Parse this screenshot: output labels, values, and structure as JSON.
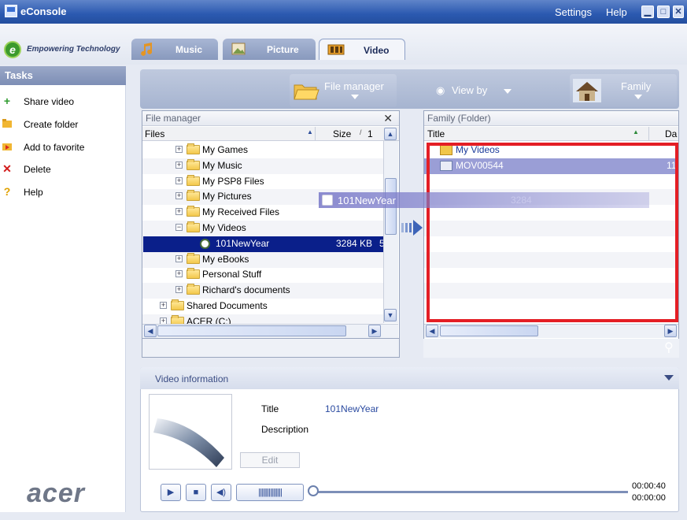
{
  "titlebar": {
    "title": "eConsole",
    "settings": "Settings",
    "help": "Help"
  },
  "brand": {
    "tagline": "Empowering Technology",
    "logo_text": "acer"
  },
  "tabs": [
    {
      "label": "Music",
      "icon": "music-note-icon"
    },
    {
      "label": "Picture",
      "icon": "picture-icon"
    },
    {
      "label": "Video",
      "icon": "film-icon",
      "active": true
    }
  ],
  "tasks": {
    "heading": "Tasks",
    "items": [
      {
        "label": "Share video",
        "icon": "plus-icon",
        "color": "#2e9b2e"
      },
      {
        "label": "Create folder",
        "icon": "folder-icon",
        "color": "#d99a1e"
      },
      {
        "label": "Add to favorite",
        "icon": "favorite-folder-icon",
        "color": "#d9531e"
      },
      {
        "label": "Delete",
        "icon": "delete-icon",
        "color": "#d21a1a"
      },
      {
        "label": "Help",
        "icon": "help-icon",
        "color": "#e0a100"
      }
    ]
  },
  "toolbar": {
    "file_manager": "File manager",
    "view_by": "View by",
    "family": "Family"
  },
  "left_panel": {
    "title": "File manager",
    "col_files": "Files",
    "col_size": "Size",
    "col_extra": "1",
    "rows": [
      {
        "label": "My Games",
        "indent": 2
      },
      {
        "label": "My Music",
        "indent": 2
      },
      {
        "label": "My PSP8 Files",
        "indent": 2
      },
      {
        "label": "My Pictures",
        "indent": 2
      },
      {
        "label": "My Received Files",
        "indent": 2
      },
      {
        "label": "My Videos",
        "indent": 2,
        "expanded": true
      },
      {
        "label": "101NewYear",
        "indent": 3,
        "size": "3284 KB",
        "extra": "5",
        "selected": true
      },
      {
        "label": "My eBooks",
        "indent": 2
      },
      {
        "label": "Personal Stuff",
        "indent": 2
      },
      {
        "label": "Richard's documents",
        "indent": 2
      },
      {
        "label": "Shared Documents",
        "indent": 1
      },
      {
        "label": "ACER (C:)",
        "indent": 1
      }
    ]
  },
  "drag_ghost": {
    "label": "101NewYear",
    "size": "3284"
  },
  "right_panel": {
    "title": "Family (Folder)",
    "col_title": "Title",
    "col_date": "Da",
    "rows": [
      {
        "label": "My Videos",
        "type": "folder"
      },
      {
        "label": "MOV00544",
        "date": "11/",
        "selected": true
      }
    ]
  },
  "video_info": {
    "heading": "Video information",
    "title_label": "Title",
    "title_value": "101NewYear",
    "description_label": "Description",
    "edit_label": "Edit"
  },
  "player": {
    "elapsed": "00:00:40",
    "total": "00:00:00"
  }
}
